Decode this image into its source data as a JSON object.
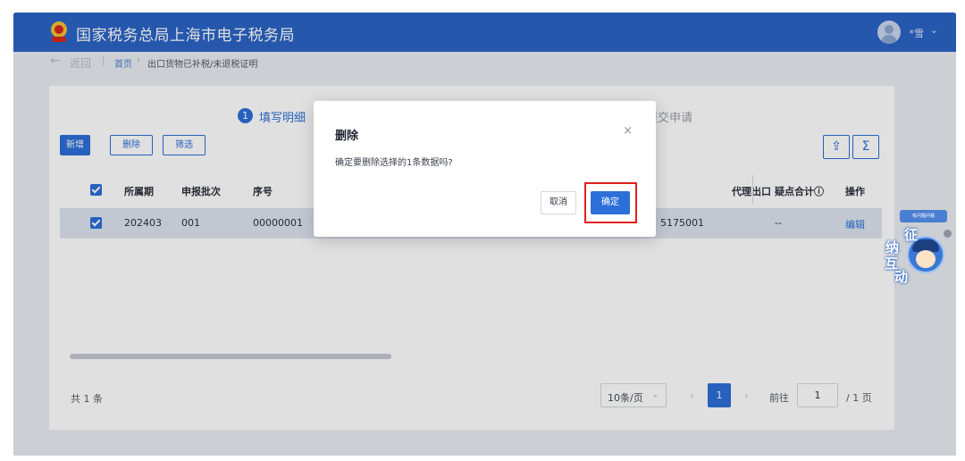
{
  "header": {
    "title": "国家税务总局上海市电子税务局",
    "user_name": "*雪",
    "caret": "⌄"
  },
  "breadcrumb": {
    "back_arrow": "←",
    "back": "返回",
    "home": "首页",
    "separator": "›",
    "current": "出口货物已补税/未退税证明"
  },
  "steps": {
    "step1_number": "1",
    "step1_label": "填写明细",
    "step2_label": "提交申请"
  },
  "toolbar": {
    "new": "新增",
    "delete": "删除",
    "filter": "筛选",
    "export_icon": "⇪",
    "sum_icon": "Σ"
  },
  "table": {
    "headers": {
      "period": "所属期",
      "batch": "申报批次",
      "serial": "序号",
      "agent": "代理出口",
      "doubt_total": "疑点合计ⓘ",
      "operation": "操作"
    },
    "row": {
      "period": "202403",
      "batch": "001",
      "serial": "00000001",
      "number_tail": "5175001",
      "doubt_total": "--",
      "operation": "编辑"
    }
  },
  "footer": {
    "total": "共 1 条",
    "page_size": "10条/页",
    "page_size_caret": "⌄",
    "prev": "‹",
    "current_page": "1",
    "next": "›",
    "jump_label": "前往",
    "jump_value": "1",
    "total_pages": "/ 1 页"
  },
  "modal": {
    "title": "删除",
    "close": "×",
    "message": "确定要删除选择的1条数据吗?",
    "cancel": "取消",
    "confirm": "确定"
  },
  "mascot": {
    "tip": "有问题问我",
    "chars": [
      "征",
      "纳",
      "互",
      "动"
    ]
  },
  "colors": {
    "header_bg": "#2b64c5",
    "accent": "#2d6fd8",
    "highlight": "#e02020"
  }
}
